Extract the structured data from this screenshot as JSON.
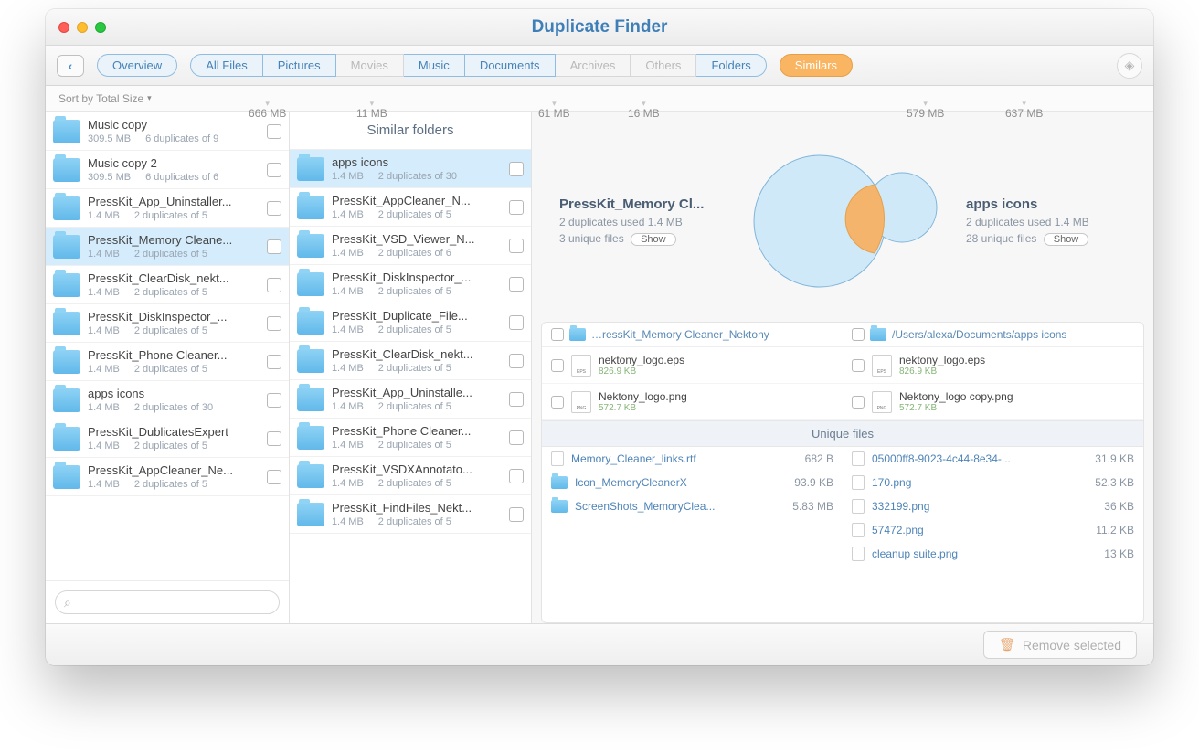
{
  "window": {
    "title": "Duplicate Finder"
  },
  "toolbar": {
    "overview": "Overview",
    "tabs": [
      {
        "label": "All Files",
        "size": "666 MB",
        "enabled": true
      },
      {
        "label": "Pictures",
        "size": "11 MB",
        "enabled": true
      },
      {
        "label": "Movies",
        "size": "",
        "enabled": false
      },
      {
        "label": "Music",
        "size": "61 MB",
        "enabled": true
      },
      {
        "label": "Documents",
        "size": "16 MB",
        "enabled": true
      },
      {
        "label": "Archives",
        "size": "",
        "enabled": false
      },
      {
        "label": "Others",
        "size": "",
        "enabled": false
      },
      {
        "label": "Folders",
        "size": "579 MB",
        "enabled": true
      }
    ],
    "similars": "Similars",
    "similars_size": "637 MB"
  },
  "sort": {
    "label": "Sort by Total Size"
  },
  "left_list": [
    {
      "name": "Music copy",
      "size": "309.5 MB",
      "dups": "6 duplicates of 9"
    },
    {
      "name": "Music copy 2",
      "size": "309.5 MB",
      "dups": "6 duplicates of 6"
    },
    {
      "name": "PressKit_App_Uninstaller...",
      "size": "1.4 MB",
      "dups": "2 duplicates of 5"
    },
    {
      "name": "PressKit_Memory Cleane...",
      "size": "1.4 MB",
      "dups": "2 duplicates of 5",
      "selected": true
    },
    {
      "name": "PressKit_ClearDisk_nekt...",
      "size": "1.4 MB",
      "dups": "2 duplicates of 5"
    },
    {
      "name": "PressKit_DiskInspector_...",
      "size": "1.4 MB",
      "dups": "2 duplicates of 5"
    },
    {
      "name": "PressKit_Phone Cleaner...",
      "size": "1.4 MB",
      "dups": "2 duplicates of 5"
    },
    {
      "name": "apps icons",
      "size": "1.4 MB",
      "dups": "2 duplicates of 30"
    },
    {
      "name": "PressKit_DublicatesExpert",
      "size": "1.4 MB",
      "dups": "2 duplicates of 5"
    },
    {
      "name": "PressKit_AppCleaner_Ne...",
      "size": "1.4 MB",
      "dups": "2 duplicates of 5"
    }
  ],
  "similar_header": "Similar folders",
  "similar_list": [
    {
      "name": "apps icons",
      "size": "1.4 MB",
      "dups": "2 duplicates of 30",
      "selected": true
    },
    {
      "name": "PressKit_AppCleaner_N...",
      "size": "1.4 MB",
      "dups": "2 duplicates of 5"
    },
    {
      "name": "PressKit_VSD_Viewer_N...",
      "size": "1.4 MB",
      "dups": "2 duplicates of 6"
    },
    {
      "name": "PressKit_DiskInspector_...",
      "size": "1.4 MB",
      "dups": "2 duplicates of 5"
    },
    {
      "name": "PressKit_Duplicate_File...",
      "size": "1.4 MB",
      "dups": "2 duplicates of 5"
    },
    {
      "name": "PressKit_ClearDisk_nekt...",
      "size": "1.4 MB",
      "dups": "2 duplicates of 5"
    },
    {
      "name": "PressKit_App_Uninstalle...",
      "size": "1.4 MB",
      "dups": "2 duplicates of 5"
    },
    {
      "name": "PressKit_Phone Cleaner...",
      "size": "1.4 MB",
      "dups": "2 duplicates of 5"
    },
    {
      "name": "PressKit_VSDXAnnotato...",
      "size": "1.4 MB",
      "dups": "2 duplicates of 5"
    },
    {
      "name": "PressKit_FindFiles_Nekt...",
      "size": "1.4 MB",
      "dups": "2 duplicates of 5"
    }
  ],
  "venn": {
    "left": {
      "title": "PressKit_Memory Cl...",
      "line1": "2 duplicates used 1.4 MB",
      "line2": "3 unique files",
      "show": "Show"
    },
    "right": {
      "title": "apps icons",
      "line1": "2 duplicates used 1.4 MB",
      "line2": "28 unique files",
      "show": "Show"
    }
  },
  "detail": {
    "paths": {
      "left": "…ressKit_Memory Cleaner_Nektony",
      "right": "/Users/alexa/Documents/apps icons"
    },
    "duplicates": [
      {
        "left": {
          "name": "nektony_logo.eps",
          "size": "826.9 KB",
          "type": "eps"
        },
        "right": {
          "name": "nektony_logo.eps",
          "size": "826.9 KB",
          "type": "eps"
        }
      },
      {
        "left": {
          "name": "Nektony_logo.png",
          "size": "572.7 KB",
          "type": "png"
        },
        "right": {
          "name": "Nektony_logo copy.png",
          "size": "572.7 KB",
          "type": "png"
        }
      }
    ],
    "unique_header": "Unique files",
    "unique": [
      {
        "left": {
          "name": "Memory_Cleaner_links.rtf",
          "size": "682 B",
          "icon": "doc"
        },
        "right": {
          "name": "05000ff8-9023-4c44-8e34-...",
          "size": "31.9 KB",
          "icon": "doc"
        }
      },
      {
        "left": {
          "name": "Icon_MemoryCleanerX",
          "size": "93.9 KB",
          "icon": "folder"
        },
        "right": {
          "name": "170.png",
          "size": "52.3 KB",
          "icon": "doc"
        }
      },
      {
        "left": {
          "name": "ScreenShots_MemoryClea...",
          "size": "5.83 MB",
          "icon": "folder"
        },
        "right": {
          "name": "332199.png",
          "size": "36 KB",
          "icon": "doc"
        }
      },
      {
        "left": {
          "name": "",
          "size": "",
          "icon": ""
        },
        "right": {
          "name": "57472.png",
          "size": "11.2 KB",
          "icon": "doc"
        }
      },
      {
        "left": {
          "name": "",
          "size": "",
          "icon": ""
        },
        "right": {
          "name": "cleanup suite.png",
          "size": "13 KB",
          "icon": "doc"
        }
      }
    ]
  },
  "footer": {
    "remove": "Remove selected"
  }
}
